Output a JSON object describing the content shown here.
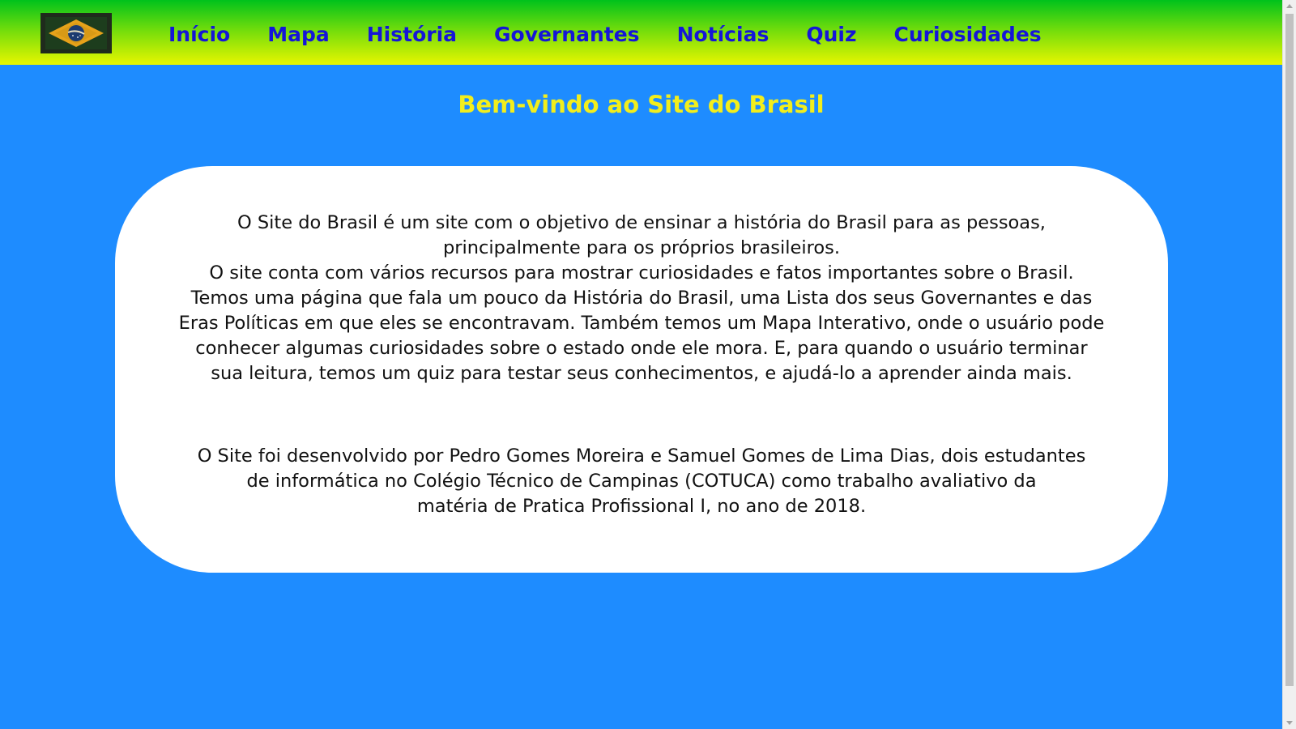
{
  "header": {
    "logo_icon": "brazil-flag-icon",
    "nav": [
      {
        "label": "Início"
      },
      {
        "label": "Mapa"
      },
      {
        "label": "História"
      },
      {
        "label": "Governantes"
      },
      {
        "label": "Notícias"
      },
      {
        "label": "Quiz"
      },
      {
        "label": "Curiosidades"
      }
    ]
  },
  "main": {
    "title": "Bem-vindo ao Site do Brasil",
    "intro_lines": [
      "O Site do Brasil é um site com o objetivo de ensinar a história do Brasil para as pessoas,",
      "principalmente para os próprios brasileiros.",
      "O site conta com vários recursos para mostrar curiosidades e fatos importantes sobre o Brasil.",
      "Temos uma página que fala um pouco da História do Brasil, uma Lista dos seus Governantes e das",
      "Eras Políticas em que eles se encontravam. Também temos um Mapa Interativo, onde o usuário pode",
      "conhecer algumas curiosidades sobre o estado onde ele mora. E, para quando o usuário terminar",
      "sua leitura, temos um quiz para testar seus conhecimentos, e ajudá-lo a aprender ainda mais."
    ],
    "credits_lines": [
      "O Site foi desenvolvido por Pedro Gomes Moreira e Samuel Gomes de Lima Dias, dois estudantes",
      "de informática no Colégio Técnico de Campinas (COTUCA) como trabalho avaliativo da",
      "matéria de Pratica Profissional I, no ano de 2018."
    ]
  },
  "colors": {
    "background": "#1e8cff",
    "nav_text": "#1515d8",
    "title_text": "#f2ee1c",
    "header_gradient_top": "#00c21c",
    "header_gradient_bottom": "#e8f600"
  }
}
